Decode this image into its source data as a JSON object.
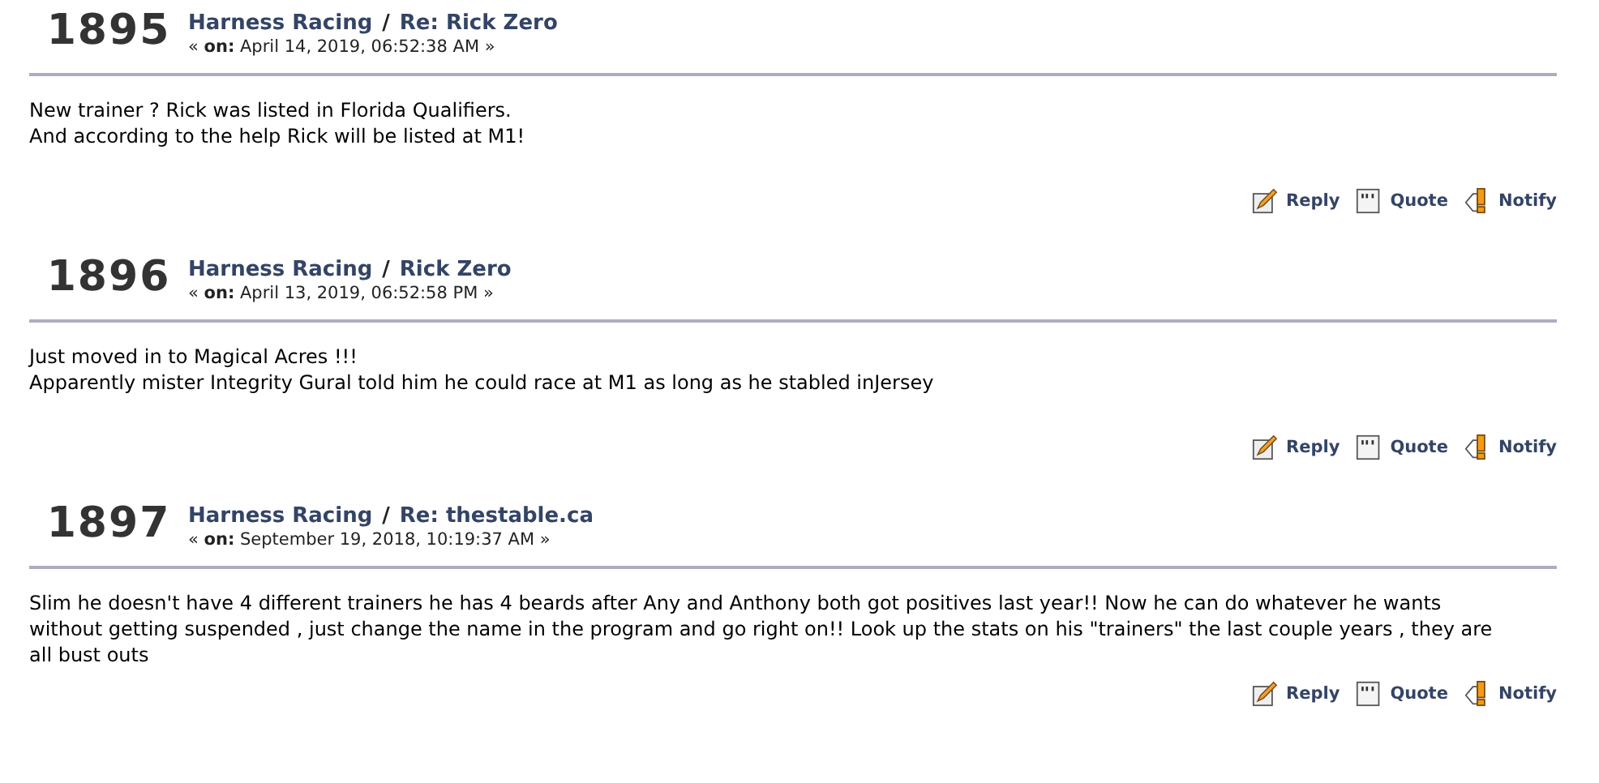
{
  "posts": [
    {
      "number": "1895",
      "board": "Harness Racing",
      "separator": "/",
      "subject": "Re: Rick Zero",
      "date": "« **on:** April 14, 2019, 06:52:38 AM »",
      "body": [
        "New trainer ? Rick was listed in Florida Qualifiers.",
        "And according to the help Rick will be listed at M1!"
      ],
      "actions": [
        {
          "kind": "reply",
          "label": "Reply"
        },
        {
          "kind": "quote",
          "label": "Quote"
        },
        {
          "kind": "notify",
          "label": "Notify"
        }
      ]
    },
    {
      "number": "1896",
      "board": "Harness Racing",
      "separator": "/",
      "subject": "Rick Zero",
      "date": "« **on:** April 13, 2019, 06:52:58 PM »",
      "body": [
        "Just moved in to Magical Acres !!!",
        "Apparently mister Integrity Gural told him he could race at M1 as long as he stabled inJersey"
      ],
      "actions": [
        {
          "kind": "reply",
          "label": "Reply"
        },
        {
          "kind": "quote",
          "label": "Quote"
        },
        {
          "kind": "notify",
          "label": "Notify"
        }
      ]
    },
    {
      "number": "1897",
      "board": "Harness Racing",
      "separator": "/",
      "subject": "Re: thestable.ca",
      "date": "« **on:** September 19, 2018, 10:19:37 AM »",
      "body": [
        "Slim he doesn't have 4 different trainers he has 4 beards after Any and Anthony both got positives last year!! Now he can do whatever he wants without getting suspended , just change the name in the program and go right on!! Look up the stats on his \"trainers\" the last couple years , they are all bust outs"
      ],
      "actions": [
        {
          "kind": "reply",
          "label": "Reply"
        },
        {
          "kind": "quote",
          "label": "Quote"
        },
        {
          "kind": "notify",
          "label": "Notify"
        }
      ]
    }
  ]
}
